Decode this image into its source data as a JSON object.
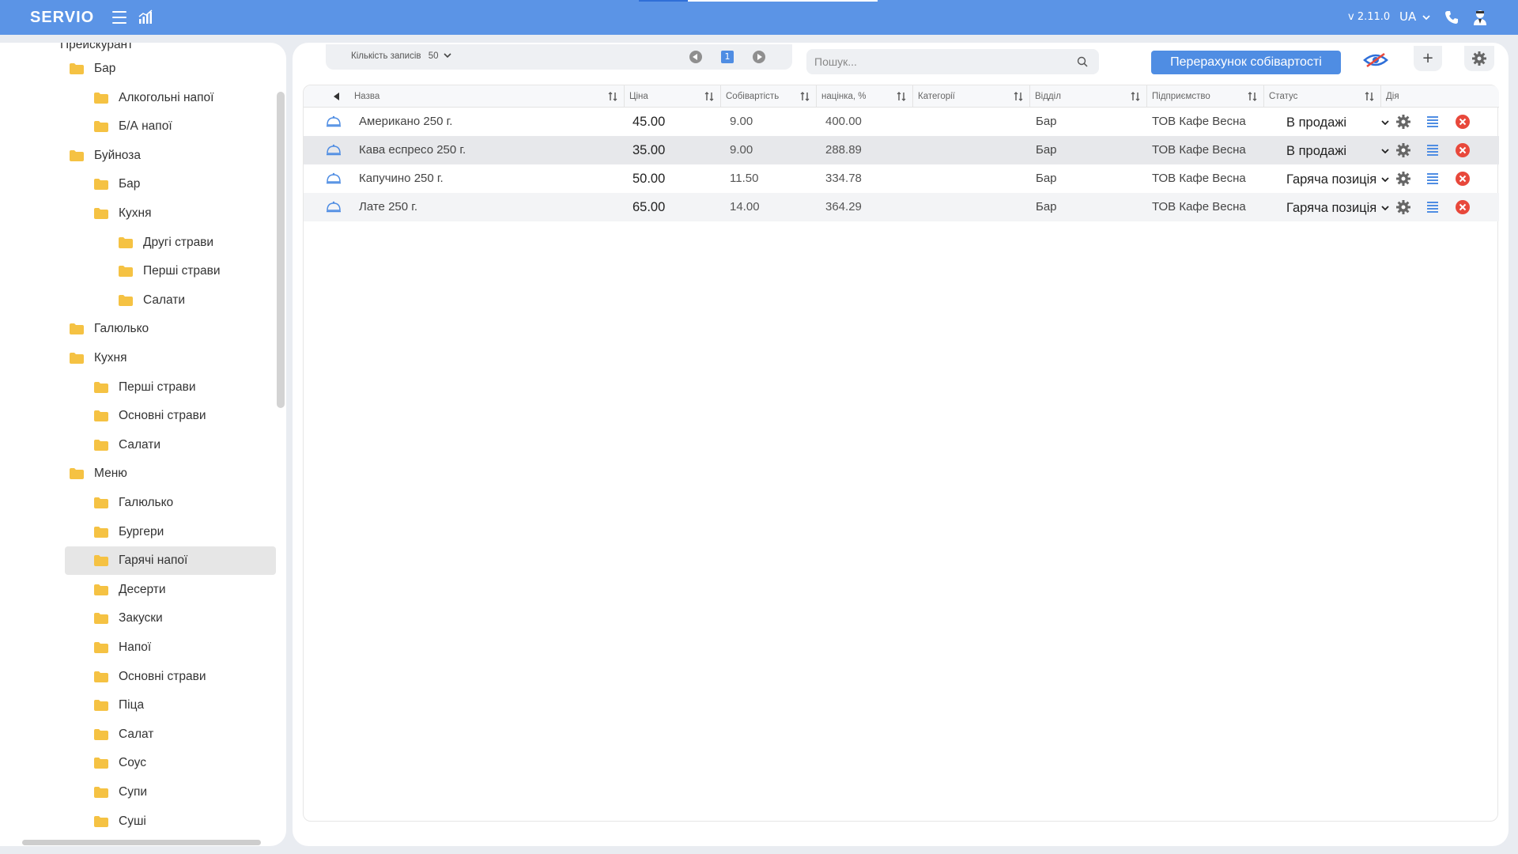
{
  "app": {
    "logo": "SERVIO",
    "version": "v 2.11.0",
    "language": "UA"
  },
  "sidebar": {
    "root": "Прейскурант",
    "items": [
      {
        "label": "Бар",
        "level": 1
      },
      {
        "label": "Алкогольні напої",
        "level": 2
      },
      {
        "label": "Б/А напої",
        "level": 2
      },
      {
        "label": "Буйноза",
        "level": 1
      },
      {
        "label": "Бар",
        "level": 2
      },
      {
        "label": "Кухня",
        "level": 2
      },
      {
        "label": "Другі страви",
        "level": 3
      },
      {
        "label": "Перші страви",
        "level": 3
      },
      {
        "label": "Салати",
        "level": 3
      },
      {
        "label": "Галюлько",
        "level": 1
      },
      {
        "label": "Кухня",
        "level": 1
      },
      {
        "label": "Перші страви",
        "level": 2
      },
      {
        "label": "Основні страви",
        "level": 2
      },
      {
        "label": "Салати",
        "level": 2
      },
      {
        "label": "Меню",
        "level": 1
      },
      {
        "label": "Галюлько",
        "level": 2
      },
      {
        "label": "Бургери",
        "level": 2
      },
      {
        "label": "Гарячі напої",
        "level": 2,
        "selected": true
      },
      {
        "label": "Десерти",
        "level": 2
      },
      {
        "label": "Закуски",
        "level": 2
      },
      {
        "label": "Напої",
        "level": 2
      },
      {
        "label": "Основні страви",
        "level": 2
      },
      {
        "label": "Піца",
        "level": 2
      },
      {
        "label": "Салат",
        "level": 2
      },
      {
        "label": "Соус",
        "level": 2
      },
      {
        "label": "Супи",
        "level": 2
      },
      {
        "label": "Суші",
        "level": 2
      }
    ]
  },
  "toolbar": {
    "page_size_label": "Кількість записів",
    "page_size_value": "50",
    "current_page": "1",
    "search_placeholder": "Пошук...",
    "recalc_label": "Перерахунок собівартості",
    "add_label": "+"
  },
  "table": {
    "columns": [
      "Назва",
      "Ціна",
      "Собівартість",
      "націнка, %",
      "Категорії",
      "Відділ",
      "Підприємство",
      "Статус",
      "Дія"
    ],
    "rows": [
      {
        "name": "Американо 250 г.",
        "price": "45.00",
        "cost": "9.00",
        "markup": "400.00",
        "category": "",
        "department": "Бар",
        "company": "ТОВ Кафе Весна",
        "status": "В продажі"
      },
      {
        "name": "Кава еспресо 250 г.",
        "price": "35.00",
        "cost": "9.00",
        "markup": "288.89",
        "category": "",
        "department": "Бар",
        "company": "ТОВ Кафе Весна",
        "status": "В продажі"
      },
      {
        "name": "Капучино 250 г.",
        "price": "50.00",
        "cost": "11.50",
        "markup": "334.78",
        "category": "",
        "department": "Бар",
        "company": "ТОВ Кафе Весна",
        "status": "Гаряча позиція"
      },
      {
        "name": "Лате 250 г.",
        "price": "65.00",
        "cost": "14.00",
        "markup": "364.29",
        "category": "",
        "department": "Бар",
        "company": "ТОВ Кафе Весна",
        "status": "Гаряча позиція"
      }
    ]
  },
  "colors": {
    "topbar": "#5b94e6",
    "accent": "#4f8de3",
    "folder": "#f5c243",
    "delete": "#e8483b"
  }
}
